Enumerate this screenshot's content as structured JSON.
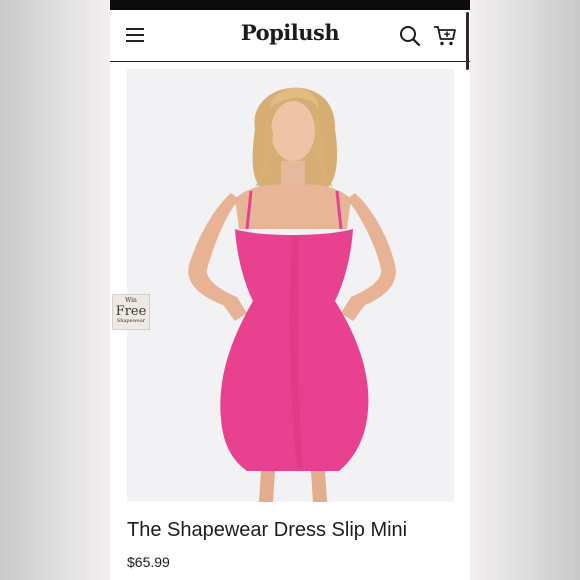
{
  "header": {
    "menu_icon": "hamburger-menu-icon",
    "brand": "Popilush",
    "search_icon": "search-icon",
    "cart_icon": "cart-icon"
  },
  "promo_badge": {
    "line1": "Win",
    "line2": "Free",
    "line3": "Shapewear"
  },
  "product": {
    "title": "The Shapewear Dress Slip Mini",
    "price": "$65.99",
    "dress_color": "#e8418f"
  },
  "colors": {
    "background": "#ffffff",
    "text": "#1c1c1c",
    "status_bar": "#0c0c0c"
  }
}
